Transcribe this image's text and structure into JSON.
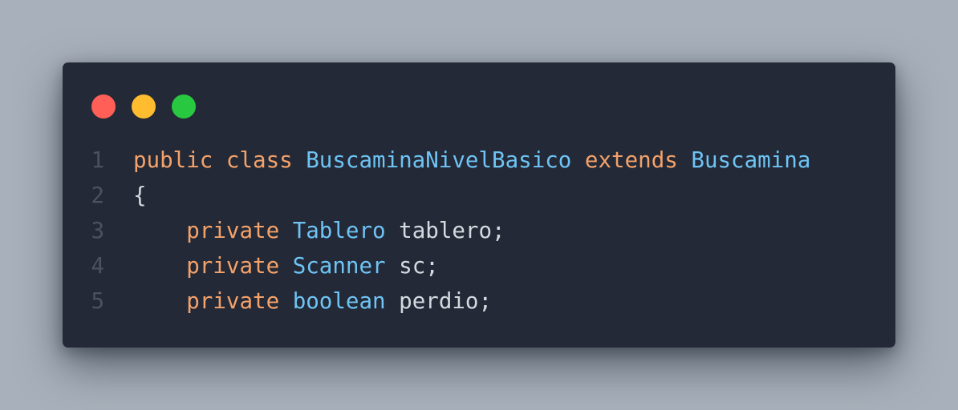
{
  "window_controls": {
    "close_color": "#ff5f57",
    "minimize_color": "#febc2e",
    "maximize_color": "#28c840"
  },
  "colors": {
    "background": "#a8b1bb",
    "editor_background": "#232936",
    "keyword": "#f5a26a",
    "type": "#6ec4f5",
    "identifier": "#d5d9e0",
    "line_number": "#4a5161"
  },
  "code": {
    "lines": [
      {
        "number": "1",
        "tokens": [
          {
            "text": "public class ",
            "kind": "keyword"
          },
          {
            "text": "BuscaminaNivelBasico",
            "kind": "type"
          },
          {
            "text": " extends ",
            "kind": "keyword"
          },
          {
            "text": "Buscamina",
            "kind": "type"
          }
        ]
      },
      {
        "number": "2",
        "tokens": [
          {
            "text": "{",
            "kind": "identifier"
          }
        ]
      },
      {
        "number": "3",
        "tokens": [
          {
            "text": "    private ",
            "kind": "keyword"
          },
          {
            "text": "Tablero",
            "kind": "type"
          },
          {
            "text": " tablero;",
            "kind": "identifier"
          }
        ]
      },
      {
        "number": "4",
        "tokens": [
          {
            "text": "    private ",
            "kind": "keyword"
          },
          {
            "text": "Scanner",
            "kind": "type"
          },
          {
            "text": " sc;",
            "kind": "identifier"
          }
        ]
      },
      {
        "number": "5",
        "tokens": [
          {
            "text": "    private ",
            "kind": "keyword"
          },
          {
            "text": "boolean",
            "kind": "type"
          },
          {
            "text": " perdio;",
            "kind": "identifier"
          }
        ]
      }
    ]
  }
}
